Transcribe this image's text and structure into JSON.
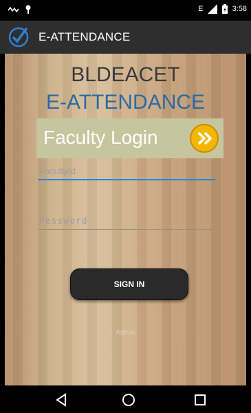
{
  "status_bar": {
    "network": "E",
    "time": "3:58"
  },
  "app_bar": {
    "title": "E-ATTENDANCE"
  },
  "main": {
    "heading1": "BLDEACET",
    "heading2": "E-ATTENDANCE",
    "banner_text": "Faculty Login",
    "faculty_placeholder": "FacultyId",
    "password_placeholder": "Password",
    "signin_label": "SIGN IN",
    "admin_link": "Admin"
  },
  "nav_bar": {
    "back": "back-icon",
    "home": "home-icon",
    "recents": "recents-icon"
  },
  "colors": {
    "accent": "#1e88e5",
    "title_blue": "#2a6aa6",
    "arrow_yellow": "#f2b705"
  }
}
